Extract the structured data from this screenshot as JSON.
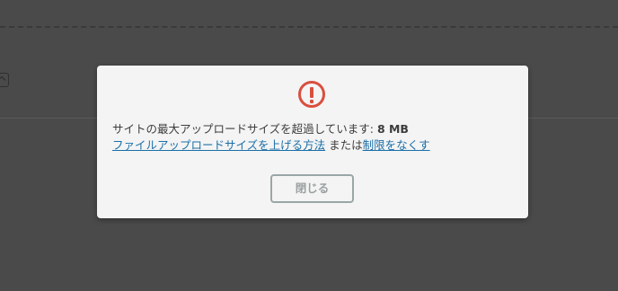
{
  "modal": {
    "icon": "warning-circle-icon",
    "message": {
      "text": "サイトの最大アップロードサイズを超過しています: ",
      "size": "8 MB",
      "help_link": "ファイルアップロードサイズを上げる方法",
      "or_text": " または",
      "remove_limit_link": "制限をなくす"
    },
    "close_label": "閉じる"
  },
  "colors": {
    "background": "#4a4a4a",
    "modal_background": "#f4f4f4",
    "warning": "#d94f3f",
    "link": "#1b6fa8",
    "close_border": "#9aa6a6"
  }
}
